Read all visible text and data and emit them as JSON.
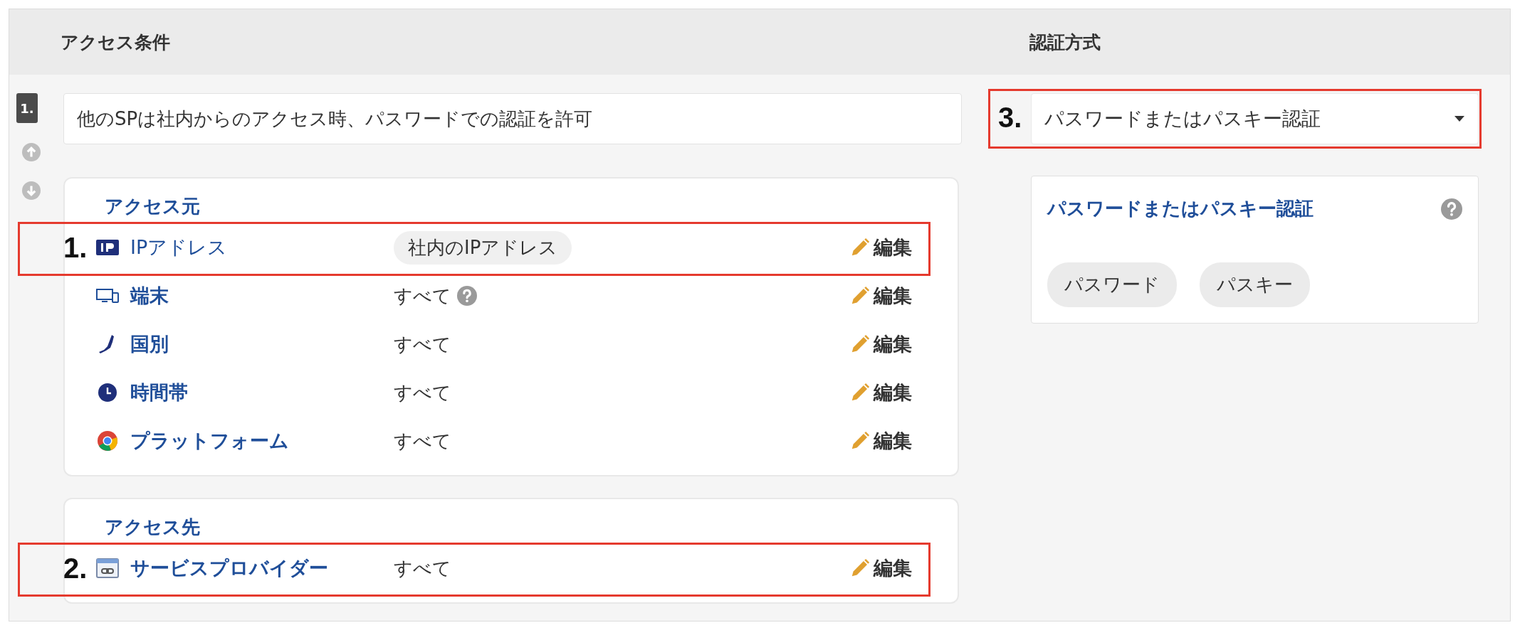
{
  "headers": [
    {
      "label": "アクセス条件"
    },
    {
      "label": "認証方式"
    }
  ],
  "rule": {
    "number": "1.",
    "name": "他のSPは社内からのアクセス時、パスワードでの認証を許可",
    "sections": [
      {
        "title": "アクセス元",
        "items": [
          {
            "kind": "ip",
            "label": "IPアドレス",
            "value": "社内のIPアドレス",
            "value_tagged": true,
            "help": false,
            "edit": "編集",
            "annotation": "1."
          },
          {
            "kind": "device",
            "label": "端末",
            "value": "すべて",
            "value_tagged": false,
            "help": true,
            "edit": "編集"
          },
          {
            "kind": "country",
            "label": "国別",
            "value": "すべて",
            "value_tagged": false,
            "help": false,
            "edit": "編集"
          },
          {
            "kind": "time",
            "label": "時間帯",
            "value": "すべて",
            "value_tagged": false,
            "help": false,
            "edit": "編集"
          },
          {
            "kind": "platform",
            "label": "プラットフォーム",
            "value": "すべて",
            "value_tagged": false,
            "help": false,
            "edit": "編集"
          }
        ]
      },
      {
        "title": "アクセス先",
        "items": [
          {
            "kind": "provider",
            "label": "サービスプロバイダー",
            "value": "すべて",
            "value_tagged": false,
            "help": false,
            "edit": "編集",
            "annotation": "2."
          }
        ]
      }
    ]
  },
  "auth": {
    "select": "パスワードまたはパスキー認証",
    "annotation": "3.",
    "card_title": "パスワードまたはパスキー認証",
    "help": true,
    "methods": [
      "パスワード",
      "パスキー"
    ]
  }
}
